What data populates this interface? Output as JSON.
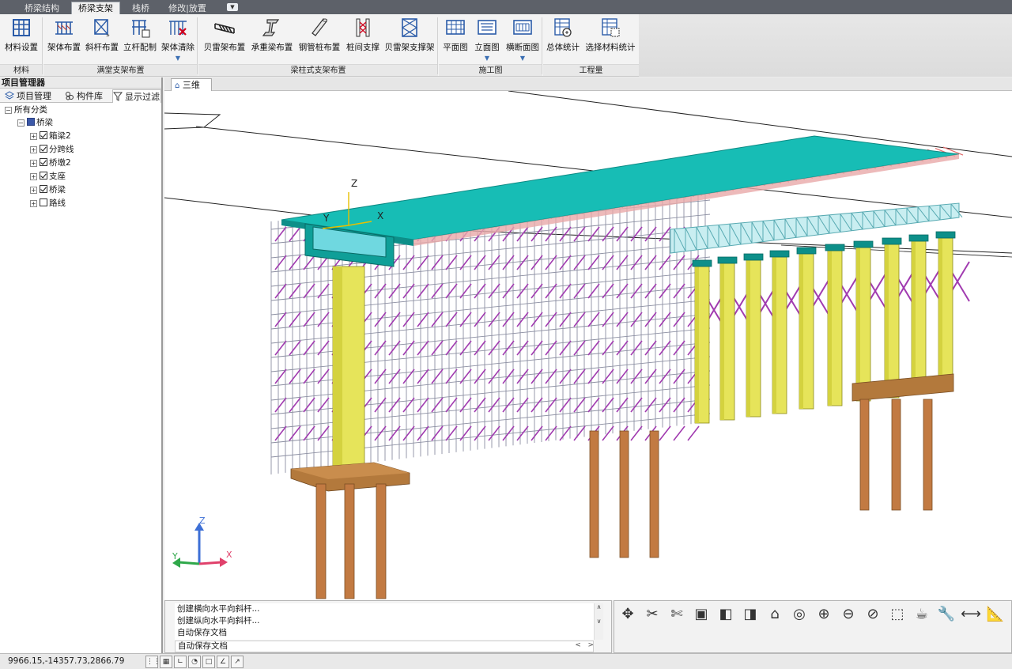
{
  "tabs": [
    {
      "label": "桥梁结构",
      "active": false
    },
    {
      "label": "桥梁支架",
      "active": true
    },
    {
      "label": "栈桥",
      "active": false
    },
    {
      "label": "修改|放置",
      "active": false
    }
  ],
  "ribbon": {
    "groups": [
      {
        "title": "材料",
        "buttons": [
          {
            "label": "材料设置",
            "icon": "material-grid-icon"
          }
        ]
      },
      {
        "title": "满堂支架布置",
        "buttons": [
          {
            "label": "架体布置",
            "icon": "frame-layout-icon"
          },
          {
            "label": "斜杆布置",
            "icon": "diagonal-bar-icon"
          },
          {
            "label": "立杆配制",
            "icon": "vertical-bar-config-icon"
          },
          {
            "label": "架体清除",
            "icon": "frame-clear-icon",
            "dropdown": true
          }
        ]
      },
      {
        "title": "梁柱式支架布置",
        "buttons": [
          {
            "label": "贝雷架布置",
            "icon": "bailey-truss-icon"
          },
          {
            "label": "承重梁布置",
            "icon": "bearing-beam-icon"
          },
          {
            "label": "钢管桩布置",
            "icon": "steel-pipe-pile-icon"
          },
          {
            "label": "桩间支撑",
            "icon": "pile-bracing-icon"
          },
          {
            "label": "贝雷架支撑架",
            "icon": "bailey-support-icon"
          }
        ]
      },
      {
        "title": "施工图",
        "buttons": [
          {
            "label": "平面图",
            "icon": "plan-view-icon"
          },
          {
            "label": "立面图",
            "icon": "elevation-view-icon",
            "dropdown": true
          },
          {
            "label": "横断面图",
            "icon": "cross-section-icon",
            "dropdown": true
          }
        ]
      },
      {
        "title": "工程量",
        "buttons": [
          {
            "label": "总体统计",
            "icon": "total-stats-icon"
          },
          {
            "label": "选择材料统计",
            "icon": "select-material-stats-icon"
          }
        ]
      }
    ]
  },
  "left_panel": {
    "title": "项目管理器",
    "tabs": [
      "项目管理",
      "构件库",
      "显示过滤"
    ],
    "tree": {
      "root": "所有分类",
      "node": "桥梁",
      "children": [
        "箱梁2",
        "分跨线",
        "桥墩2",
        "支座",
        "桥梁",
        "路线"
      ],
      "checked": [
        true,
        true,
        true,
        true,
        true,
        false
      ]
    }
  },
  "viewport": {
    "tab_label": "三维",
    "axis": {
      "z": "Z",
      "y": "Y",
      "x": "X"
    }
  },
  "command": {
    "log": [
      "创建横向水平向斜杆...",
      "创建纵向水平向斜杆...",
      "自动保存文档"
    ],
    "input": "自动保存文档"
  },
  "tools": [
    "move-icon",
    "cut-icon",
    "split-icon",
    "box-view-icon",
    "front-view-icon",
    "side-view-icon",
    "home-view-icon",
    "orbit-icon",
    "zoom-extents-icon",
    "zoom-in-icon",
    "zoom-window-icon",
    "select-box-icon",
    "teapot-render-icon",
    "wrench-icon",
    "measure-icon",
    "ruler-icon"
  ],
  "status": {
    "coords": "9966.15,-14357.73,2866.79"
  },
  "colors": {
    "deck": "#17bdb5",
    "scaffold_purple": "#a13bb0",
    "pier_yellow": "#e6e45a",
    "pile_brown": "#c27a42",
    "pile_cap": "#b3793c"
  }
}
